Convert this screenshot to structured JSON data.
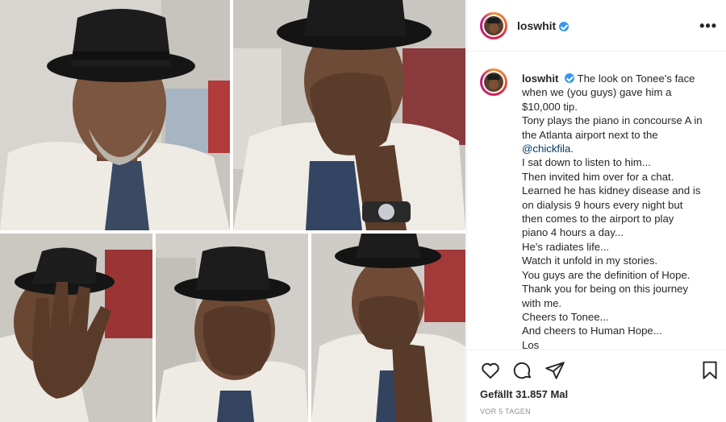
{
  "post": {
    "username": "loswhit",
    "more_label": "•••",
    "caption_lines": [
      "The look on Tonee's face",
      "when we (you guys) gave him a",
      "$10,000 tip.",
      "Tony plays the piano in concourse A in",
      "the Atlanta airport next to the",
      "@chickfila.",
      "I sat down to listen to him...",
      "Then invited him over for a chat.",
      "Learned he has kidney disease and is",
      "on dialysis 9 hours every night but",
      "then comes to the airport to play",
      "piano 4 hours a day...",
      "He's radiates life...",
      "Watch it unfold in my stories.",
      "You guys are the definition of Hope.",
      "Thank you for being on this journey",
      "with me.",
      "Cheers to Tonee...",
      "And cheers to Human Hope...",
      "Los"
    ],
    "likes": "Gefällt 31.857 Mal",
    "timestamp": "VOR 5 TAGEN"
  },
  "icons": {
    "avatar": "profile-avatar",
    "verified": "verified-badge-icon",
    "like": "heart-icon",
    "comment": "comment-bubble-icon",
    "share": "paper-plane-icon",
    "save": "bookmark-icon"
  },
  "colors": {
    "verified_blue": "#3897f0",
    "mention_blue": "#00376b",
    "muted_gray": "#8e8e8e"
  }
}
